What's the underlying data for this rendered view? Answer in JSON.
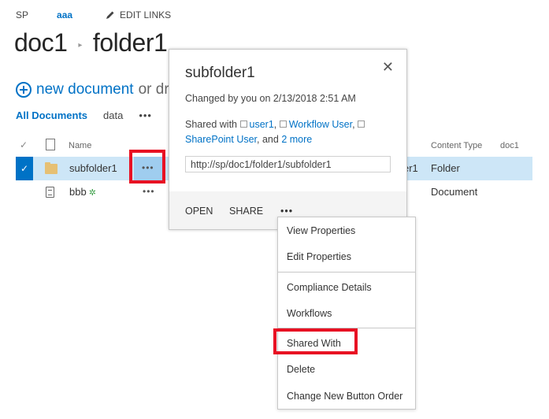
{
  "topnav": {
    "site": "SP",
    "current": "aaa",
    "edit_links": "EDIT LINKS"
  },
  "breadcrumb": {
    "parent": "doc1",
    "separator": "▸",
    "current": "folder1"
  },
  "new_document": {
    "label": "new document",
    "suffix": "or dra"
  },
  "views": {
    "all_documents": "All Documents",
    "data": "data",
    "more": "•••"
  },
  "list": {
    "headers": {
      "check": "✓",
      "name": "Name",
      "content_type": "Content Type",
      "doc1": "doc1"
    },
    "rows": [
      {
        "name": "subfolder1",
        "type": "folder",
        "ellipsis": "•••",
        "partial_modified_by": "er1",
        "content_type": "Folder",
        "selected": true,
        "check": "✓"
      },
      {
        "name": "bbb",
        "type": "text-document",
        "new_badge": "✲",
        "ellipsis": "•••",
        "content_type": "Document",
        "selected": false
      }
    ]
  },
  "callout": {
    "title": "subfolder1",
    "close": "✕",
    "changed": "Changed by you on 2/13/2018 2:51 AM",
    "shared_prefix": "Shared with",
    "shared_users": [
      "user1",
      "Workflow User",
      "SharePoint User"
    ],
    "shared_and": "and",
    "shared_more": "2 more",
    "url": "http://sp/doc1/folder1/subfolder1",
    "actions": {
      "open": "OPEN",
      "share": "SHARE",
      "more": "•••"
    }
  },
  "context_menu": {
    "items": [
      "View Properties",
      "Edit Properties",
      "Compliance Details",
      "Workflows",
      "Shared With",
      "Delete",
      "Change New Button Order"
    ],
    "highlighted": "Shared With"
  },
  "colors": {
    "accent": "#0072c6",
    "selected_row": "#cde6f7",
    "highlight_box": "#e81123",
    "folder": "#e6c074",
    "new_badge": "#3fa14b"
  }
}
